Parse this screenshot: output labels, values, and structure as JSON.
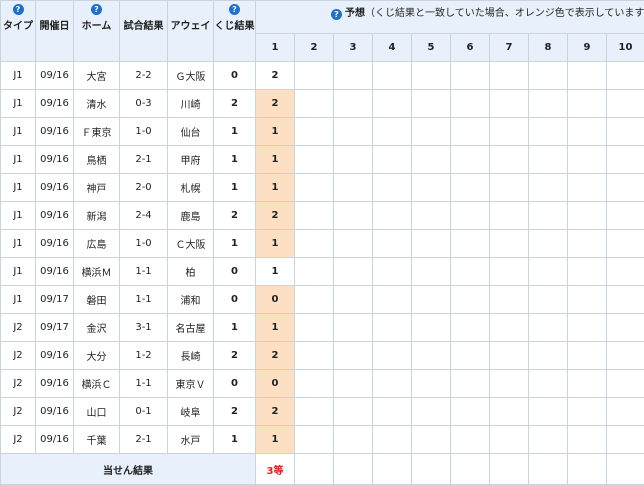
{
  "header": {
    "type_label": "タイプ",
    "date_label": "開催日",
    "home_label": "ホーム",
    "score_label": "試合結果",
    "away_label": "アウェイ",
    "kuji_label": "くじ結果",
    "prediction_label": "予想",
    "prediction_note": "（くじ結果と一致していた場合、オレンジ色で表示しています）",
    "help_icon_glyph": "?",
    "columns": [
      "1",
      "2",
      "3",
      "4",
      "5",
      "6",
      "7",
      "8",
      "9",
      "10"
    ]
  },
  "matches": [
    {
      "type": "J1",
      "date": "09/16",
      "home": "大宮",
      "score": "2-2",
      "away": "Ｇ大阪",
      "result": "0",
      "pred1": "2",
      "hit": false
    },
    {
      "type": "J1",
      "date": "09/16",
      "home": "清水",
      "score": "0-3",
      "away": "川崎",
      "result": "2",
      "pred1": "2",
      "hit": true
    },
    {
      "type": "J1",
      "date": "09/16",
      "home": "Ｆ東京",
      "score": "1-0",
      "away": "仙台",
      "result": "1",
      "pred1": "1",
      "hit": true
    },
    {
      "type": "J1",
      "date": "09/16",
      "home": "鳥栖",
      "score": "2-1",
      "away": "甲府",
      "result": "1",
      "pred1": "1",
      "hit": true
    },
    {
      "type": "J1",
      "date": "09/16",
      "home": "神戸",
      "score": "2-0",
      "away": "札幌",
      "result": "1",
      "pred1": "1",
      "hit": true
    },
    {
      "type": "J1",
      "date": "09/16",
      "home": "新潟",
      "score": "2-4",
      "away": "鹿島",
      "result": "2",
      "pred1": "2",
      "hit": true
    },
    {
      "type": "J1",
      "date": "09/16",
      "home": "広島",
      "score": "1-0",
      "away": "Ｃ大阪",
      "result": "1",
      "pred1": "1",
      "hit": true
    },
    {
      "type": "J1",
      "date": "09/16",
      "home": "横浜Ｍ",
      "score": "1-1",
      "away": "柏",
      "result": "0",
      "pred1": "1",
      "hit": false
    },
    {
      "type": "J1",
      "date": "09/17",
      "home": "磐田",
      "score": "1-1",
      "away": "浦和",
      "result": "0",
      "pred1": "0",
      "hit": true
    },
    {
      "type": "J2",
      "date": "09/17",
      "home": "金沢",
      "score": "3-1",
      "away": "名古屋",
      "result": "1",
      "pred1": "1",
      "hit": true
    },
    {
      "type": "J2",
      "date": "09/16",
      "home": "大分",
      "score": "1-2",
      "away": "長崎",
      "result": "2",
      "pred1": "2",
      "hit": true
    },
    {
      "type": "J2",
      "date": "09/16",
      "home": "横浜Ｃ",
      "score": "1-1",
      "away": "東京Ｖ",
      "result": "0",
      "pred1": "0",
      "hit": true
    },
    {
      "type": "J2",
      "date": "09/16",
      "home": "山口",
      "score": "0-1",
      "away": "岐阜",
      "result": "2",
      "pred1": "2",
      "hit": true
    },
    {
      "type": "J2",
      "date": "09/16",
      "home": "千葉",
      "score": "2-1",
      "away": "水戸",
      "result": "1",
      "pred1": "1",
      "hit": true
    }
  ],
  "footer": {
    "label": "当せん結果",
    "col1_result": "3等"
  },
  "colors": {
    "header_bg": "#e8f1fb",
    "hit_bg": "#fde0c4",
    "border": "#c9d3dd",
    "icon_blue": "#1f6fcf",
    "win_red": "#e02020"
  }
}
